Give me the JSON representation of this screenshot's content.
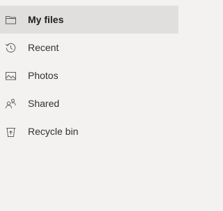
{
  "nav": {
    "items": [
      {
        "label": "My files",
        "icon": "folder-icon",
        "selected": true
      },
      {
        "label": "Recent",
        "icon": "history-icon",
        "selected": false
      },
      {
        "label": "Photos",
        "icon": "photo-icon",
        "selected": false
      },
      {
        "label": "Shared",
        "icon": "people-icon",
        "selected": false
      },
      {
        "label": "Recycle bin",
        "icon": "recycle-bin-icon",
        "selected": false
      }
    ]
  },
  "colors": {
    "background": "#f3f2f1",
    "selected_background": "#e1dfdd",
    "text": "#323130",
    "icon": "#605e5c"
  }
}
